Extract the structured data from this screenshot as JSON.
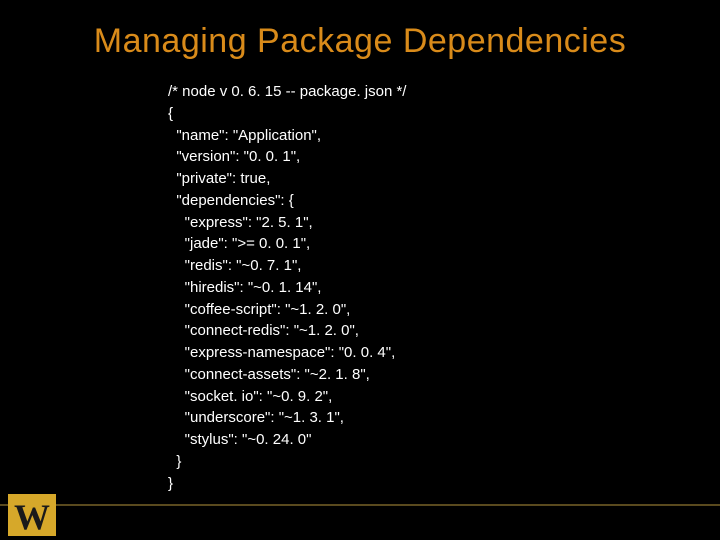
{
  "title": "Managing Package Dependencies",
  "code": {
    "comment": "/* node v 0. 6. 15 -- package. json */",
    "open": "{",
    "name_line": "  \"name\": \"Application\",",
    "version_line": "  \"version\": \"0. 0. 1\",",
    "private_line": "  \"private\": true,",
    "deps_open": "  \"dependencies\": {",
    "dep_express": "    \"express\": \"2. 5. 1\",",
    "dep_jade": "    \"jade\": \">= 0. 0. 1\",",
    "dep_redis": "    \"redis\": \"~0. 7. 1\",",
    "dep_hiredis": "    \"hiredis\": \"~0. 1. 14\",",
    "dep_coffee": "    \"coffee-script\": \"~1. 2. 0\",",
    "dep_connect_redis": "    \"connect-redis\": \"~1. 2. 0\",",
    "dep_express_ns": "    \"express-namespace\": \"0. 0. 4\",",
    "dep_connect_assets": "    \"connect-assets\": \"~2. 1. 8\",",
    "dep_socketio": "    \"socket. io\": \"~0. 9. 2\",",
    "dep_underscore": "    \"underscore\": \"~1. 3. 1\",",
    "dep_stylus": "    \"stylus\": \"~0. 24. 0\"",
    "deps_close": "  }",
    "close": "}"
  },
  "logo_letter": "W"
}
